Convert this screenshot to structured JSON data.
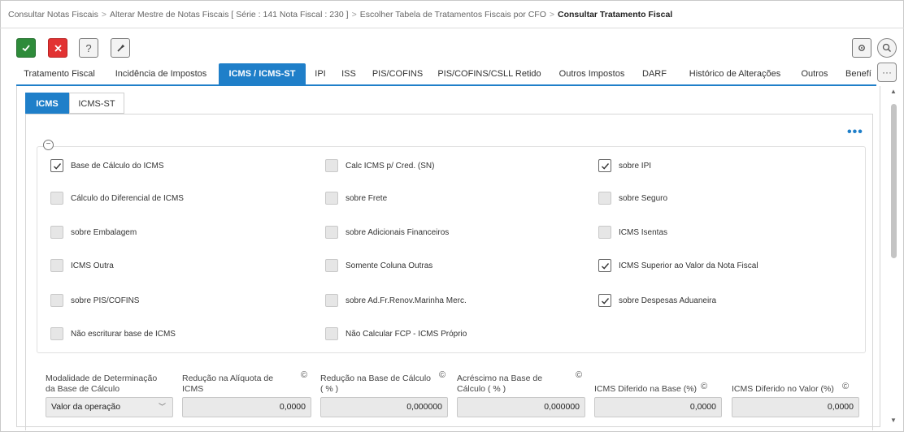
{
  "breadcrumb": {
    "items": [
      "Consultar Notas Fiscais",
      "Alterar Mestre de Notas Fiscais [ Série : 141 Nota Fiscal : 230 ]",
      "Escolher Tabela de Tratamentos Fiscais por CFO"
    ],
    "current": "Consultar Tratamento Fiscal",
    "separator": ">"
  },
  "toolbar": {
    "confirm_icon": "check-icon",
    "cancel_icon": "x-icon",
    "help_label": "?",
    "tool_icon": "wrench-icon",
    "settings_icon": "gear-icon",
    "search_icon": "search-icon",
    "more_icon": "ellipsis-icon"
  },
  "tabs": [
    {
      "label": "Tratamento Fiscal"
    },
    {
      "label": "Incidência de Impostos"
    },
    {
      "label": "ICMS / ICMS-ST",
      "active": true
    },
    {
      "label": "IPI"
    },
    {
      "label": "ISS"
    },
    {
      "label": "PIS/COFINS"
    },
    {
      "label": "PIS/COFINS/CSLL Retido"
    },
    {
      "label": "Outros Impostos"
    },
    {
      "label": "DARF"
    },
    {
      "label": "Histórico de Alterações"
    },
    {
      "label": "Outros"
    },
    {
      "label": "Benefí"
    }
  ],
  "subtabs": [
    {
      "label": "ICMS",
      "active": true
    },
    {
      "label": "ICMS-ST"
    }
  ],
  "panel": {
    "more_dots": "•••",
    "collapse_icon": "minus-circle-icon"
  },
  "checkboxes": [
    {
      "label": "Base de Cálculo do ICMS",
      "checked": true
    },
    {
      "label": "Calc ICMS p/ Cred. (SN)",
      "checked": false
    },
    {
      "label": "sobre IPI",
      "checked": true
    },
    {
      "label": "Cálculo do Diferencial de ICMS",
      "checked": false
    },
    {
      "label": "sobre Frete",
      "checked": false
    },
    {
      "label": "sobre Seguro",
      "checked": false
    },
    {
      "label": "sobre Embalagem",
      "checked": false
    },
    {
      "label": "sobre Adicionais Financeiros",
      "checked": false
    },
    {
      "label": "ICMS Isentas",
      "checked": false
    },
    {
      "label": "ICMS Outra",
      "checked": false
    },
    {
      "label": "Somente Coluna Outras",
      "checked": false
    },
    {
      "label": "ICMS Superior ao Valor da Nota Fiscal",
      "checked": true
    },
    {
      "label": "sobre PIS/COFINS",
      "checked": false
    },
    {
      "label": "sobre Ad.Fr.Renov.Marinha Merc.",
      "checked": false
    },
    {
      "label": "sobre Despesas Aduaneira",
      "checked": true
    },
    {
      "label": "Não escriturar base de ICMS",
      "checked": false
    },
    {
      "label": "Não Calcular FCP - ICMS Próprio",
      "checked": false
    }
  ],
  "fields": {
    "modalidade": {
      "label1": "Modalidade de Determinação",
      "label2": "da Base de Cálculo",
      "value": "Valor da operação"
    },
    "reducao_aliquota": {
      "label1": "Redução na Alíquota de",
      "label2": "ICMS",
      "value": "0,0000"
    },
    "reducao_base": {
      "label1": "Redução na Base de Cálculo",
      "label2": "( % )",
      "value": "0,000000"
    },
    "acrescimo_base": {
      "label1": "Acréscimo na Base de",
      "label2": "Cálculo ( % )",
      "value": "0,000000"
    },
    "diferido_base": {
      "label1": "ICMS Diferido na Base (%)",
      "value": "0,0000"
    },
    "diferido_valor": {
      "label1": "ICMS Diferido no Valor (%)",
      "value": "0,0000"
    }
  },
  "colors": {
    "accent": "#1f7fc9",
    "confirm": "#2e8b3a",
    "cancel": "#e23232"
  }
}
